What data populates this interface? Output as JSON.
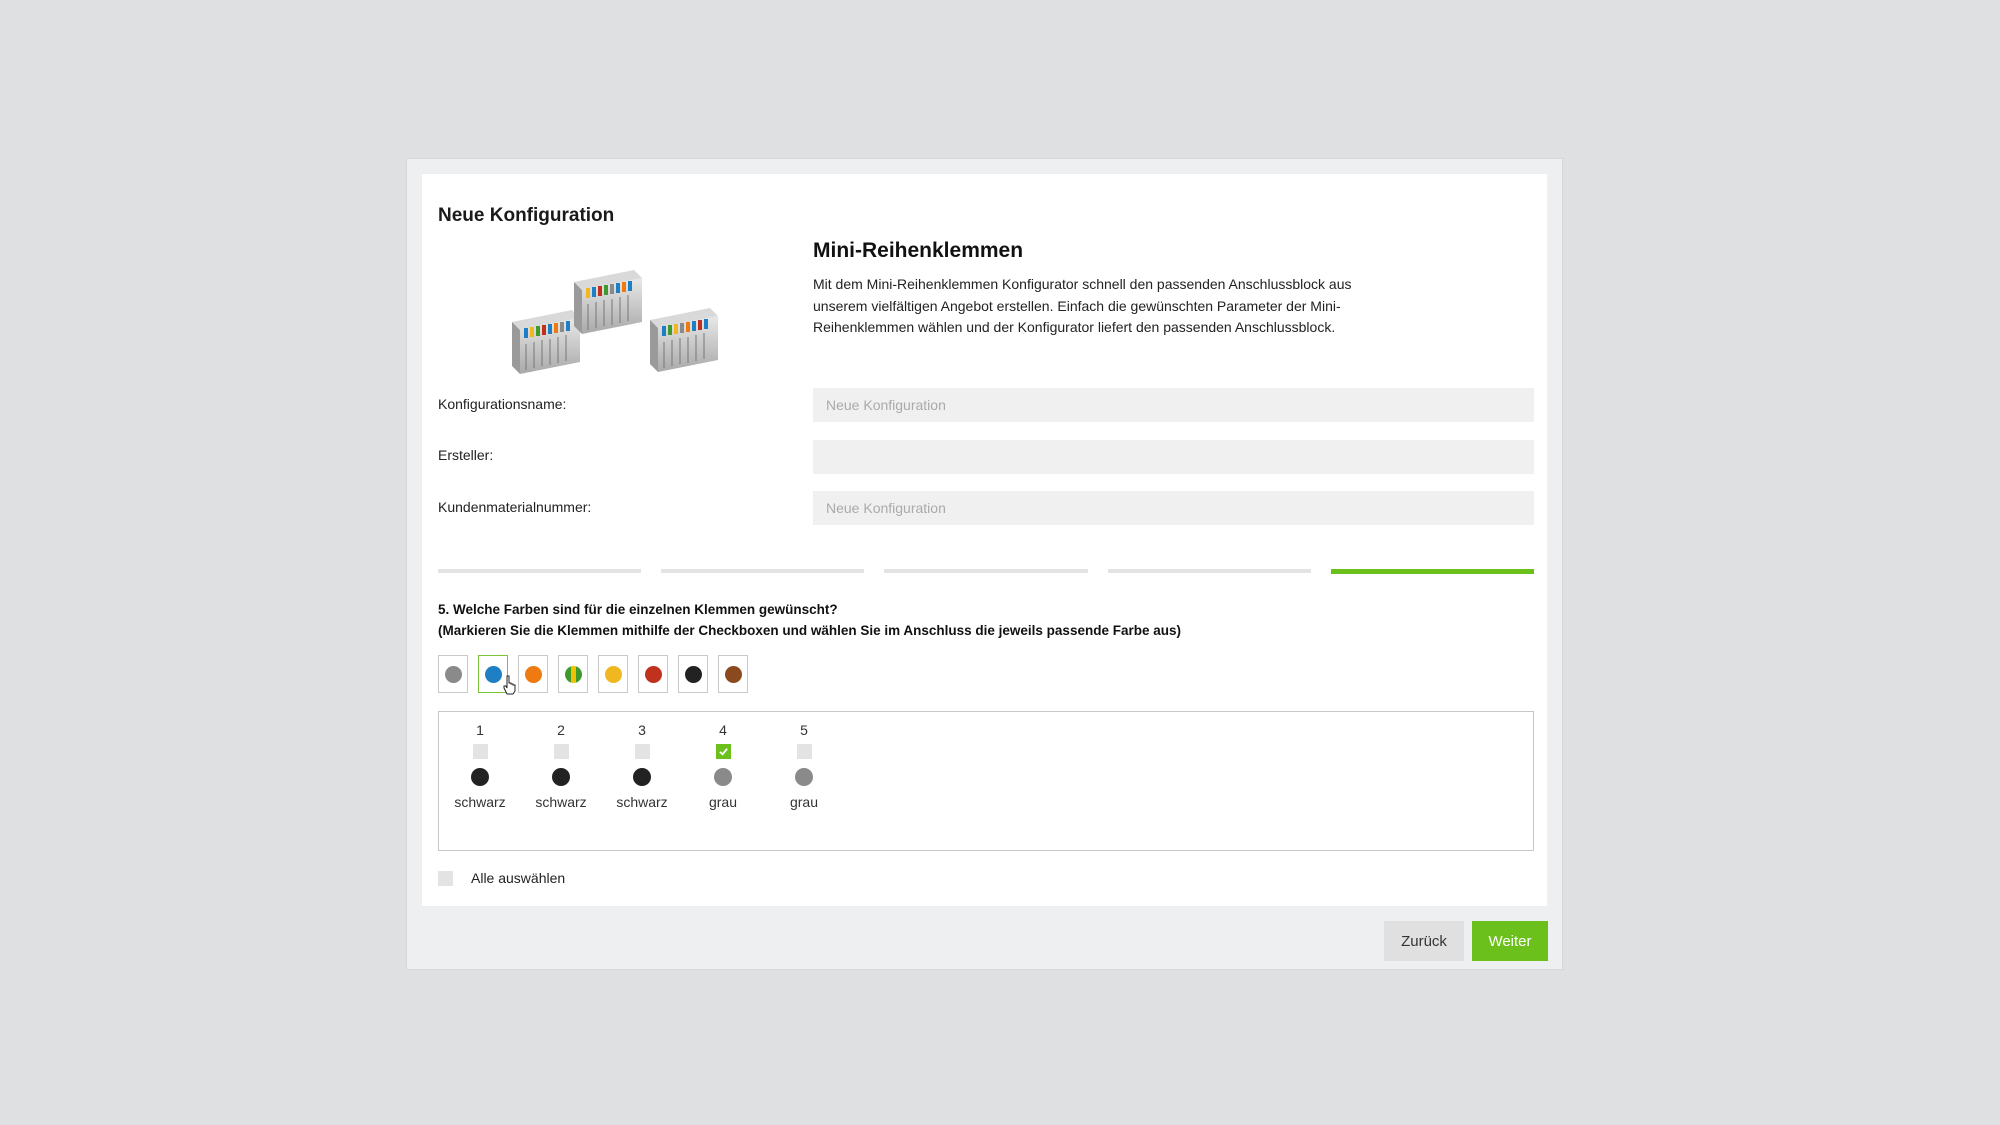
{
  "dialog": {
    "title": "Neue Konfiguration"
  },
  "product": {
    "title": "Mini-Reihenklemmen",
    "description": "Mit dem Mini-Reihenklemmen Konfigurator schnell den passenden Anschlussblock aus unserem vielfältigen Angebot erstellen. Einfach die gewünschten Parameter der Mini-Reihenklemmen wählen und der Konfigurator liefert den passenden Anschlussblock.",
    "image_icon": "terminal-block-product-image"
  },
  "form": {
    "config_name_label": "Konfigurationsname:",
    "config_name_placeholder": "Neue Konfiguration",
    "creator_label": "Ersteller:",
    "creator_value": "",
    "customer_number_label": "Kundenmaterialnummer:",
    "customer_number_placeholder": "Neue Konfiguration"
  },
  "steps": {
    "total": 5,
    "active": 5
  },
  "question": {
    "line1": "5. Welche Farben sind für die einzelnen Klemmen gewünscht?",
    "line2": "(Markieren Sie die Klemmen mithilfe der Checkboxen und wählen Sie im Anschluss die jeweils passende Farbe aus)"
  },
  "colors": {
    "accent": "#6cc01c",
    "swatches": [
      {
        "name": "grey",
        "color": "#8a8a8a"
      },
      {
        "name": "blue",
        "color": "#1f7fc4",
        "selected": true
      },
      {
        "name": "orange",
        "color": "#ee7a10"
      },
      {
        "name": "green-yellow",
        "color": "#3f9a2e",
        "stripe": "#f2c200"
      },
      {
        "name": "yellow",
        "color": "#f0b820"
      },
      {
        "name": "red",
        "color": "#c0321e"
      },
      {
        "name": "black",
        "color": "#222222"
      },
      {
        "name": "brown",
        "color": "#8a4a1e"
      }
    ]
  },
  "terminals": [
    {
      "number": "1",
      "checked": false,
      "color_name": "schwarz",
      "color": "#222222"
    },
    {
      "number": "2",
      "checked": false,
      "color_name": "schwarz",
      "color": "#222222"
    },
    {
      "number": "3",
      "checked": false,
      "color_name": "schwarz",
      "color": "#222222"
    },
    {
      "number": "4",
      "checked": true,
      "color_name": "grau",
      "color": "#8a8a8a"
    },
    {
      "number": "5",
      "checked": false,
      "color_name": "grau",
      "color": "#8a8a8a"
    }
  ],
  "select_all": {
    "label": "Alle auswählen",
    "checked": false
  },
  "buttons": {
    "back_label": "Zurück",
    "next_label": "Weiter"
  }
}
